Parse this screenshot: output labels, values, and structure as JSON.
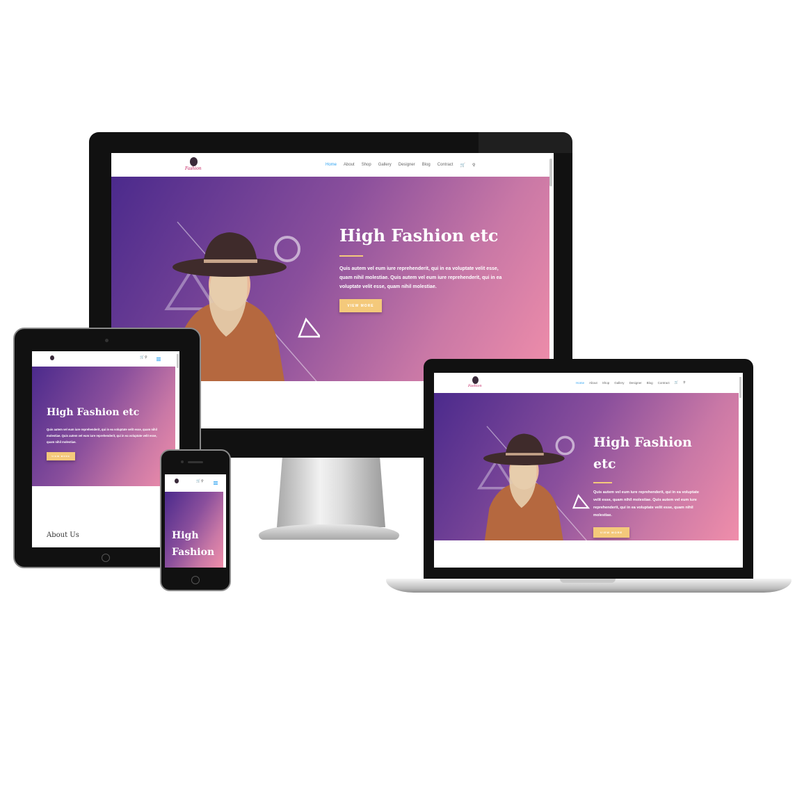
{
  "site": {
    "logo_text": "Fashion",
    "nav": [
      "Home",
      "About",
      "Shop",
      "Gallery",
      "Designer",
      "Blog",
      "Contract"
    ],
    "active_nav": "Home",
    "hero_title": "High Fashion etc",
    "hero_title_line1": "High Fashion",
    "hero_title_line2": "etc",
    "hero_mobile_line1": "High",
    "hero_mobile_line2": "Fashion",
    "hero_text": "Quis autem vel eum iure reprehenderit, qui in ea voluptate velit esse, quam nihil molestiae. Quis autem vel eum iure reprehenderit, qui in ea voluptate velit esse, quam nihil molestiae.",
    "button_label": "VIEW MORE",
    "about_heading": "About Us"
  },
  "icons": {
    "cart": "cart-icon",
    "search": "search-icon",
    "menu": "hamburger-icon"
  },
  "colors": {
    "accent": "#2ea3f2",
    "button": "#f4c97b",
    "gradient_start": "#4b2a8c",
    "gradient_end": "#f08eaa"
  }
}
